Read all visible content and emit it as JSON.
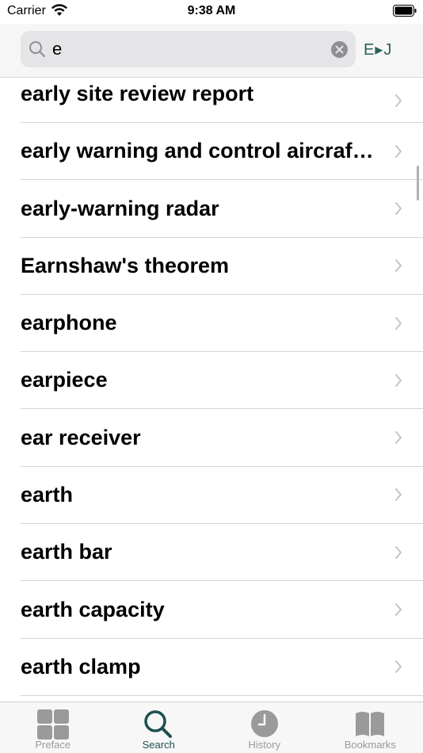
{
  "status_bar": {
    "carrier": "Carrier",
    "time": "9:38 AM"
  },
  "search": {
    "value": "e",
    "direction_label": "E▸J"
  },
  "results": [
    {
      "label": "early site review report"
    },
    {
      "label": "early warning and control aircraft system"
    },
    {
      "label": "early-warning radar"
    },
    {
      "label": "Earnshaw's theorem"
    },
    {
      "label": "earphone"
    },
    {
      "label": "earpiece"
    },
    {
      "label": "ear receiver"
    },
    {
      "label": "earth"
    },
    {
      "label": "earth bar"
    },
    {
      "label": "earth capacity"
    },
    {
      "label": "earth clamp"
    }
  ],
  "tab_bar": {
    "active_tab": "search",
    "tabs": [
      {
        "label": "Preface",
        "icon": "grid-icon"
      },
      {
        "label": "Search",
        "icon": "search-icon"
      },
      {
        "label": "History",
        "icon": "clock-icon"
      },
      {
        "label": "Bookmarks",
        "icon": "book-icon"
      }
    ]
  },
  "colors": {
    "accent": "#1f4f4f",
    "inactive": "#9a9a9a"
  }
}
